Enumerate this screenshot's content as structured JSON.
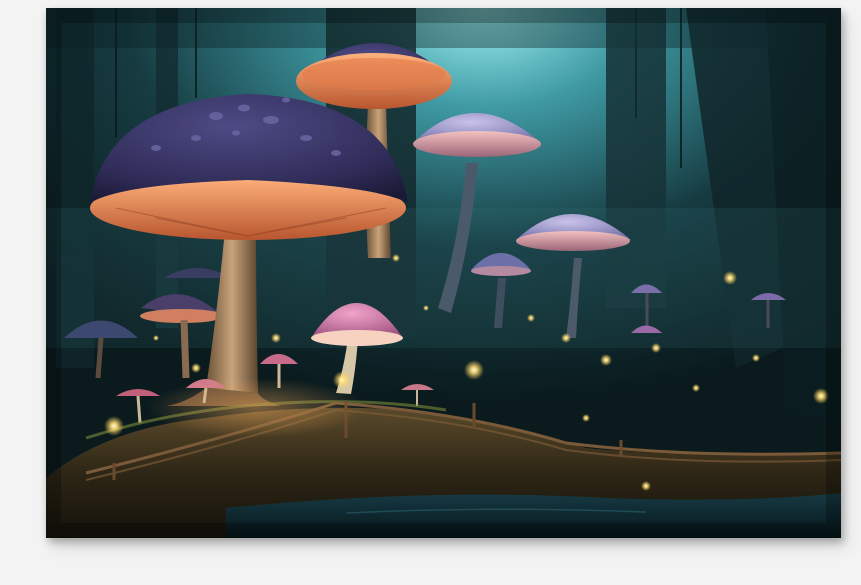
{
  "artwork": {
    "subject": "mushroom-forest-canvas-print",
    "palette": {
      "sky_glow": "#7ee3ea",
      "forest_dark": "#0b1e22",
      "mid_teal": "#1f4d55",
      "cap_purple": "#3b3b6e",
      "cap_violet": "#9a8fc4",
      "gill_orange": "#f08a5a",
      "gill_pink": "#e7a3a8",
      "stem_tan": "#c9a37a",
      "firefly": "#ffe7a0",
      "ground_brown": "#3a2e1c",
      "water": "#0e2a33"
    },
    "elements": {
      "main_mushroom": "large-purple-mushroom",
      "secondary_mushroom": "tall-orange-gill-mushroom",
      "background_mushrooms": "pale-violet-mushrooms",
      "lights": "firefly-lights",
      "path": "wooden-walkway",
      "stream": "dark-water"
    }
  }
}
